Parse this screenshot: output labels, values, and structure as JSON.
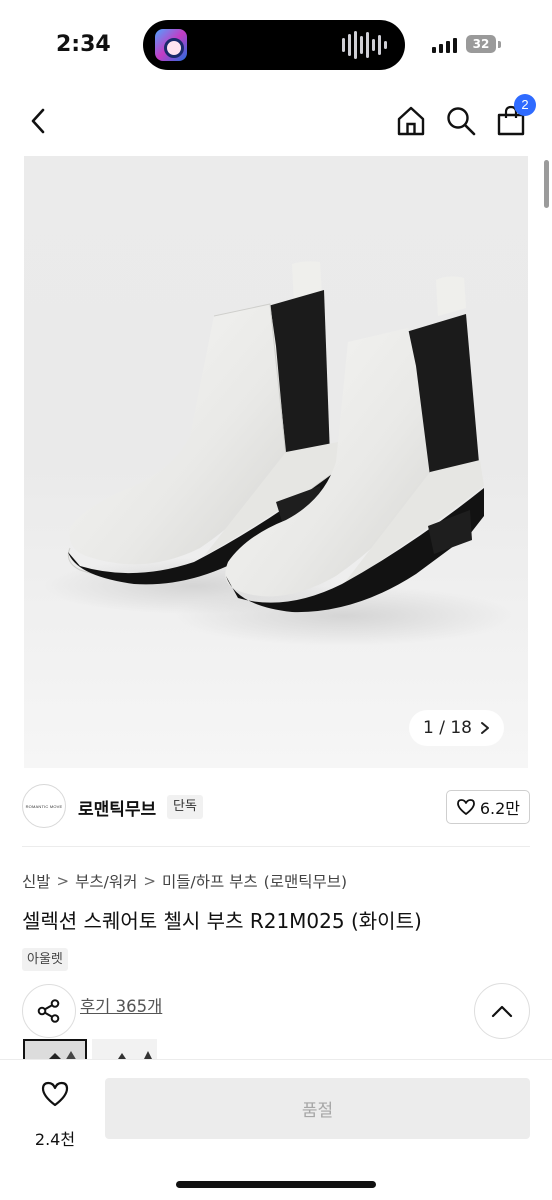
{
  "status_bar": {
    "time": "2:34",
    "battery": "32"
  },
  "nav": {
    "cart_count": "2"
  },
  "gallery": {
    "counter": "1 / 18"
  },
  "brand": {
    "logo_text": "ROMANTIC MOVE",
    "name": "로맨틱무브",
    "exclusive_tag": "단독",
    "likes": "6.2만"
  },
  "breadcrumb": [
    "신발",
    "부츠/워커",
    "미들/하프 부츠",
    "(로맨틱무브)"
  ],
  "product": {
    "title": "셀렉션 스퀘어토 첼시 부츠 R21M025 (화이트)",
    "outlet_tag": "아울렛",
    "reviews": "후기 365개"
  },
  "bottom_bar": {
    "wish_count": "2.4천",
    "buy_label": "품절"
  },
  "colors": {
    "accent_badge": "#2f6bff",
    "disabled_button": "#ececec"
  }
}
